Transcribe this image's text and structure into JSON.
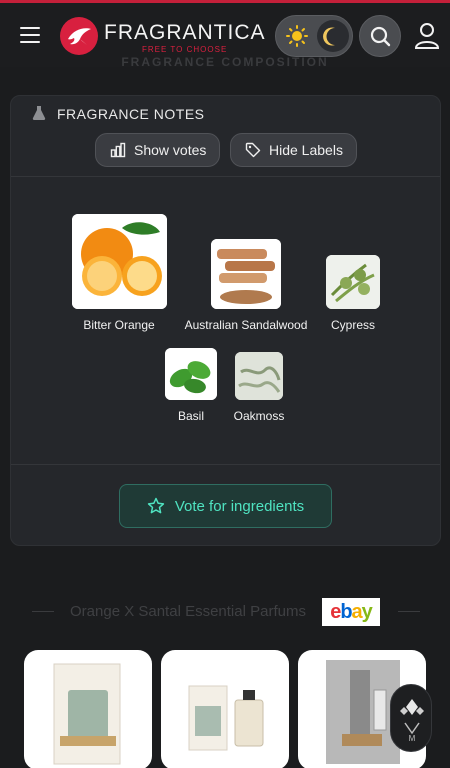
{
  "header": {
    "brand": "FRAGRANTICA",
    "tagline": "FREE TO CHOOSE",
    "section_ghost": "FRAGRANCE COMPOSITION"
  },
  "notes_card": {
    "title": "FRAGRANCE NOTES",
    "show_votes_label": "Show votes",
    "hide_labels_label": "Hide Labels",
    "notes": [
      {
        "name": "Bitter Orange"
      },
      {
        "name": "Australian Sandalwood"
      },
      {
        "name": "Cypress"
      },
      {
        "name": "Basil"
      },
      {
        "name": "Oakmoss"
      }
    ],
    "vote_label": "Vote for ingredients"
  },
  "shop": {
    "heading": "Orange X Santal Essential Parfums",
    "store_logo": "ebay"
  },
  "colors": {
    "brand_red": "#d8203f",
    "accent_teal": "#4fe3c1"
  }
}
